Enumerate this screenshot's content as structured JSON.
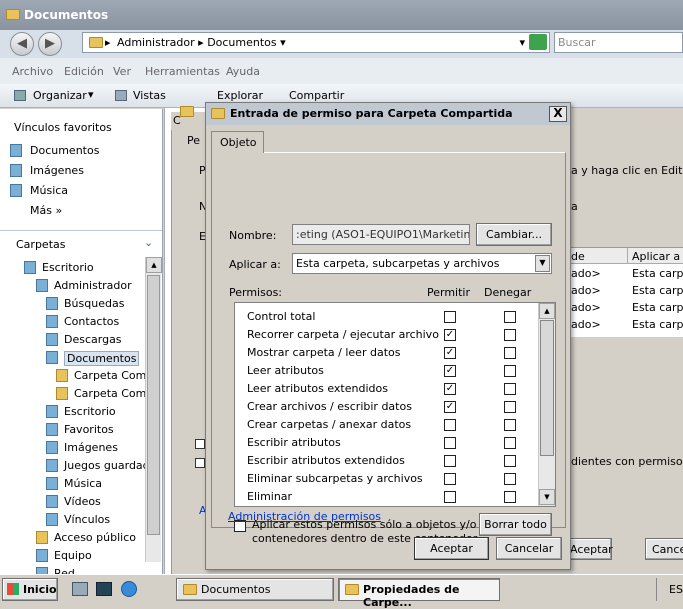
{
  "explorer": {
    "title": "Documentos",
    "address": [
      "Administrador",
      "Documentos"
    ],
    "search_placeholder": "Buscar",
    "menu": [
      "Archivo",
      "Edición",
      "Ver",
      "Herramientas",
      "Ayuda"
    ],
    "toolbar": {
      "organize": "Organizar",
      "views": "Vistas",
      "explore": "Explorar",
      "share": "Compartir"
    },
    "favorites_header": "Vínculos favoritos",
    "favorites": [
      "Documentos",
      "Imágenes",
      "Música"
    ],
    "more": "Más",
    "folders_header": "Carpetas",
    "tree": [
      "Escritorio",
      "Administrador",
      "Búsquedas",
      "Contactos",
      "Descargas",
      "Documentos",
      "Carpeta Comp",
      "Carpeta Comp",
      "Escritorio",
      "Favoritos",
      "Imágenes",
      "Juegos guardado",
      "Música",
      "Vídeos",
      "Vínculos",
      "Acceso público",
      "Equipo",
      "Red"
    ]
  },
  "background_dialog": {
    "fragments": {
      "tab_letter": "Pe",
      "title_letter": "C",
      "row_p": "P",
      "row_n": "N",
      "row_e": "E",
      "row_a": "A",
      "label_a": "Ac",
      "edit_hint": "a y haga clic en Editar.",
      "a_hint": "a"
    },
    "table_headers": [
      "de",
      "Aplicar a"
    ],
    "table_rows": [
      [
        "ado>",
        "Esta carp"
      ],
      [
        "ado>",
        "Esta carp"
      ],
      [
        "ado>",
        "Esta carp"
      ],
      [
        "ado>",
        "Esta carp"
      ]
    ],
    "inherit_hint": "dientes con permisos her",
    "accept": "Aceptar",
    "cancel": "Cance"
  },
  "dialog": {
    "title": "Entrada de permiso para Carpeta Compartida",
    "close": "X",
    "tab": "Objeto",
    "name_label": "Nombre:",
    "name_value": ":eting (ASO1-EQUIPO1\\Marketing)",
    "change_button": "Cambiar...",
    "apply_label": "Aplicar a:",
    "apply_value": "Esta carpeta, subcarpetas y archivos",
    "permissions_label": "Permisos:",
    "allow_header": "Permitir",
    "deny_header": "Denegar",
    "permissions": [
      {
        "name": "Control total",
        "allow": false,
        "deny": false
      },
      {
        "name": "Recorrer carpeta / ejecutar archivo",
        "allow": true,
        "deny": false
      },
      {
        "name": "Mostrar carpeta / leer datos",
        "allow": true,
        "deny": false
      },
      {
        "name": "Leer atributos",
        "allow": true,
        "deny": false
      },
      {
        "name": "Leer atributos extendidos",
        "allow": true,
        "deny": false
      },
      {
        "name": "Crear archivos / escribir datos",
        "allow": true,
        "deny": false
      },
      {
        "name": "Crear carpetas / anexar datos",
        "allow": false,
        "deny": false
      },
      {
        "name": "Escribir atributos",
        "allow": false,
        "deny": false
      },
      {
        "name": "Escribir atributos extendidos",
        "allow": false,
        "deny": false
      },
      {
        "name": "Eliminar subcarpetas y archivos",
        "allow": false,
        "deny": false
      },
      {
        "name": "Eliminar",
        "allow": false,
        "deny": false
      }
    ],
    "apply_only_text": [
      "Aplicar estos permisos sólo a objetos y/o",
      "contenedores dentro de este contenedor"
    ],
    "clear_all": "Borrar todo",
    "manage_link": "Administración de permisos",
    "ok": "Aceptar",
    "cancel": "Cancelar"
  },
  "taskbar": {
    "start": "Inicio",
    "tasks": [
      "Documentos",
      "Propiedades de Carpe..."
    ],
    "tray": "ES"
  },
  "colors": {
    "link": "#0033cc",
    "title_bar": "#8a94a1"
  }
}
